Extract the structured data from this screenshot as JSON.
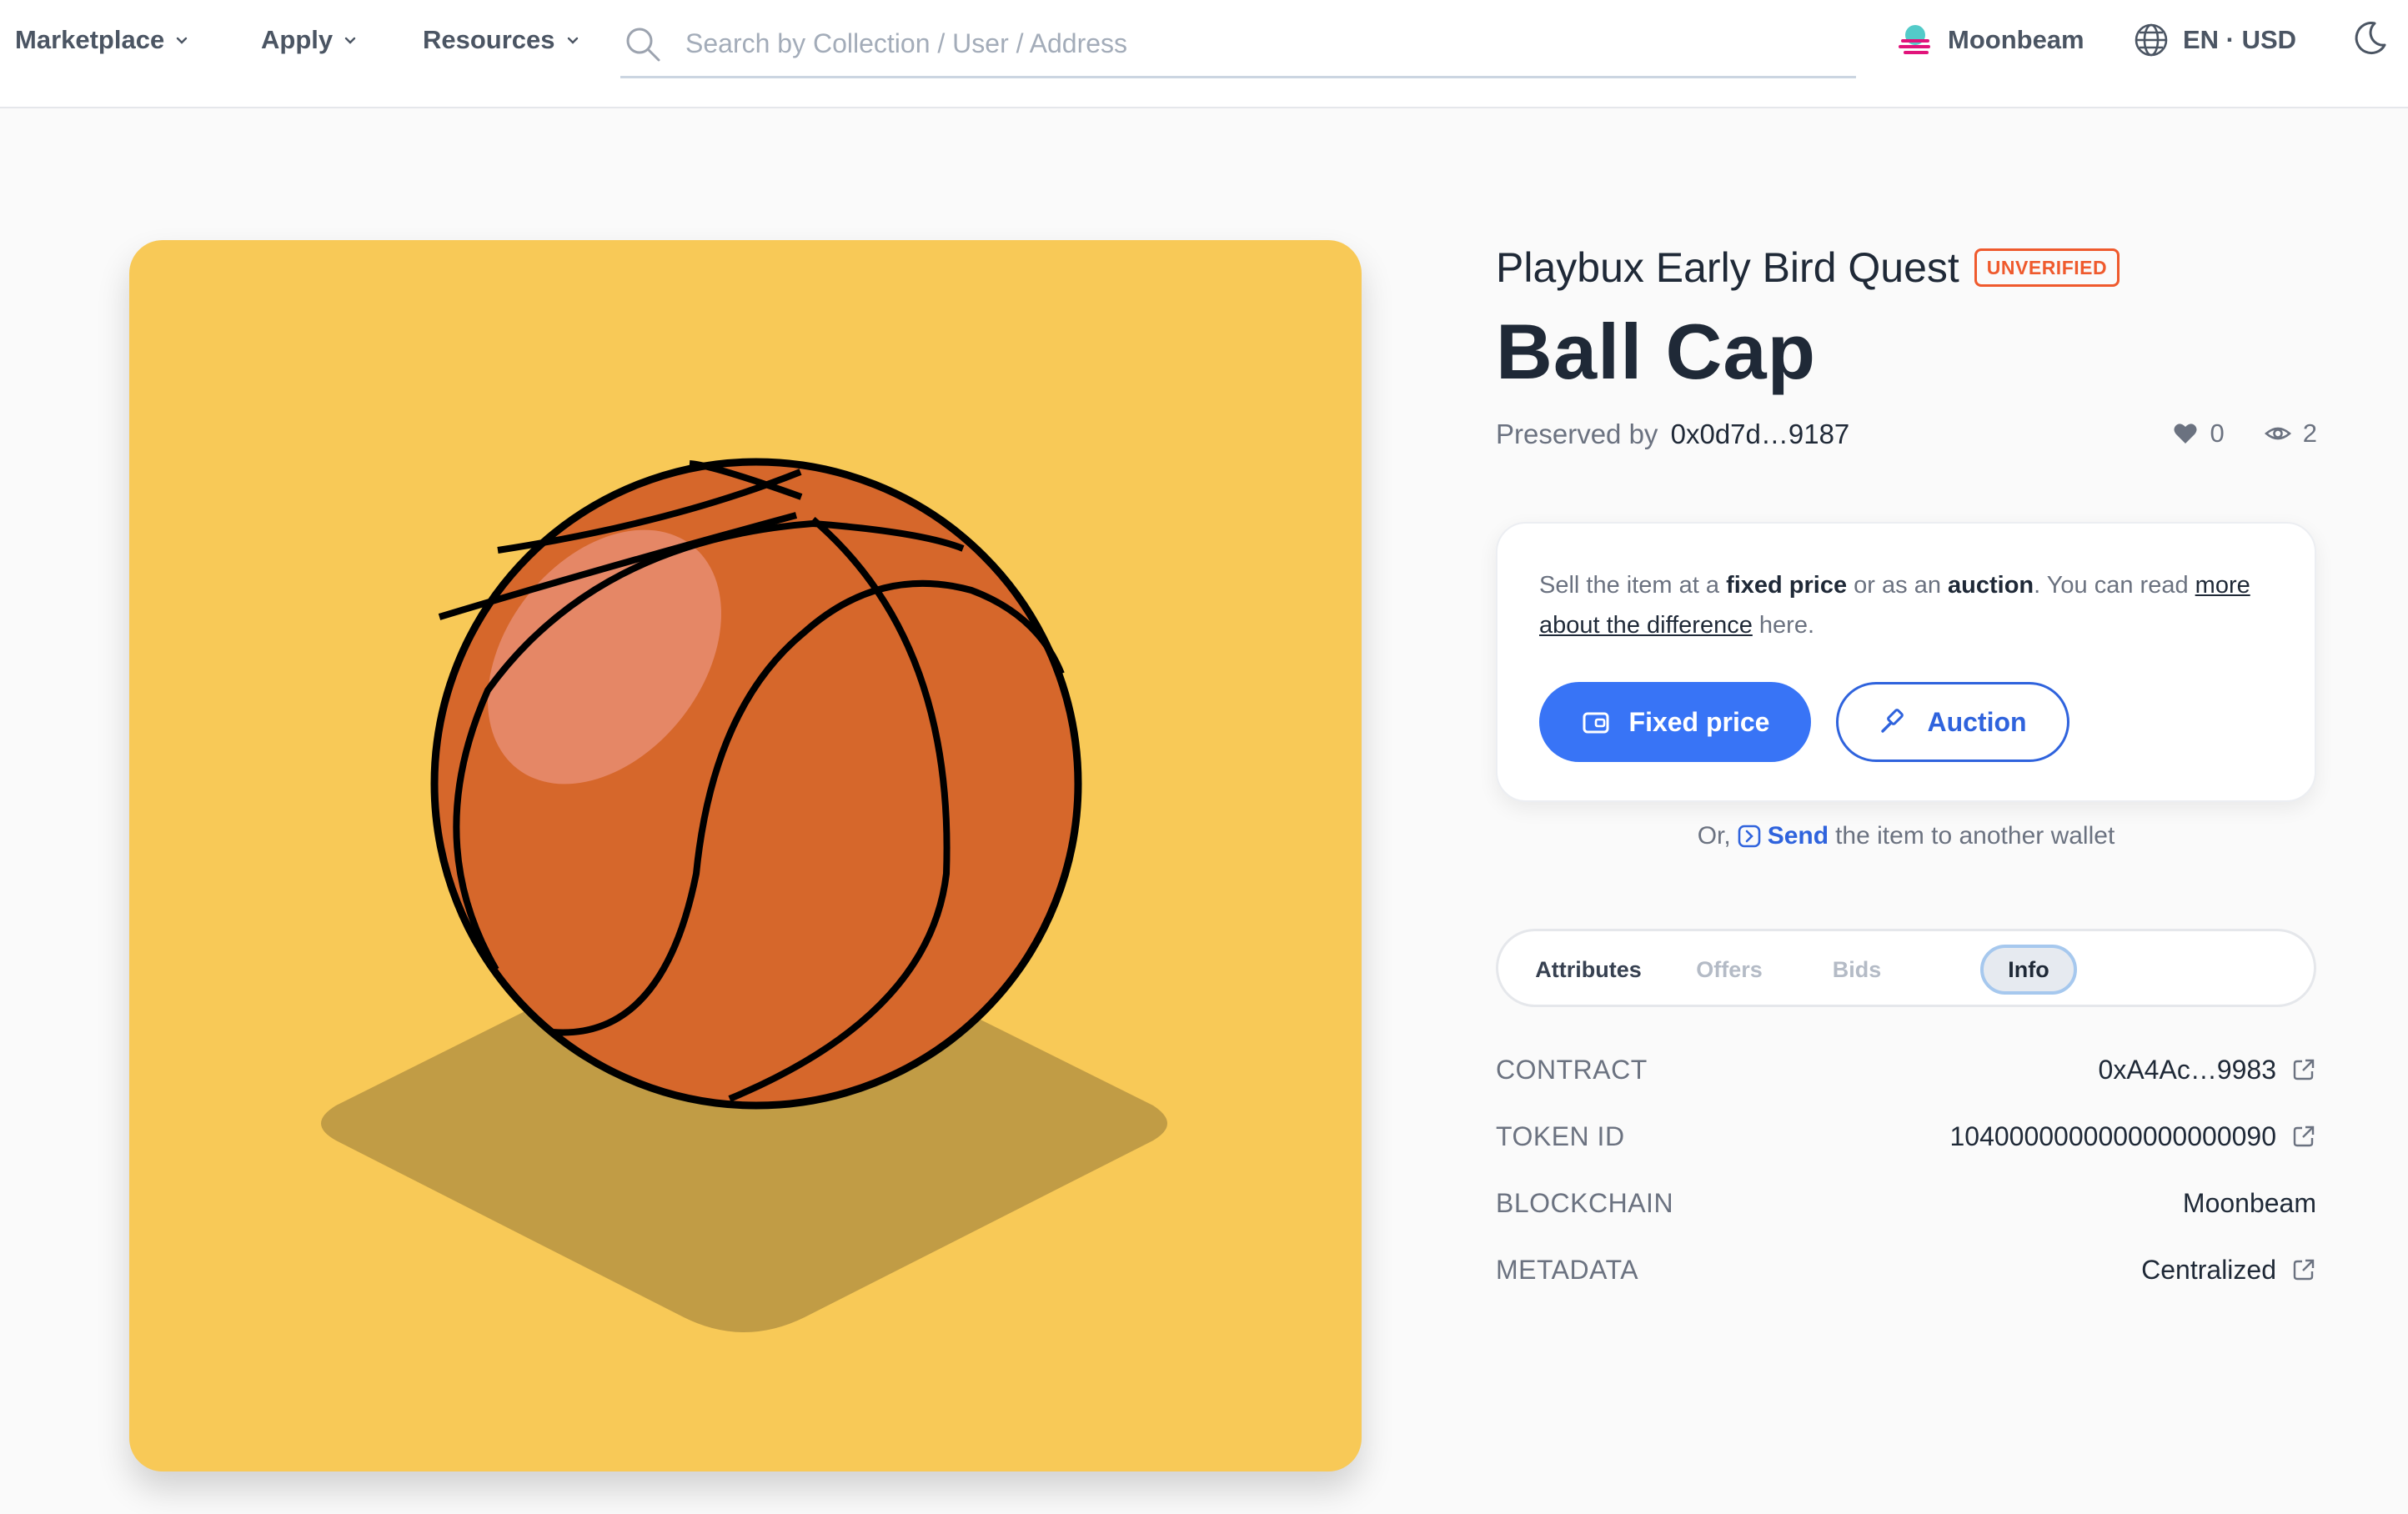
{
  "nav": {
    "marketplace": "Marketplace",
    "apply": "Apply",
    "resources": "Resources"
  },
  "search": {
    "placeholder": "Search by Collection / User / Address"
  },
  "network": {
    "name": "Moonbeam",
    "locale": "EN · USD"
  },
  "item": {
    "collection": "Playbux Early Bird Quest",
    "badge": "UNVERIFIED",
    "title": "Ball Cap",
    "owner_prefix": "Preserved by",
    "owner": "0x0d7d…9187",
    "likes": "0",
    "views": "2"
  },
  "sell": {
    "text_1": "Sell the item at a ",
    "fixed_word": "fixed price",
    "text_2": " or as an ",
    "auction_word": "auction",
    "text_3": ". You can read ",
    "link": "more about the difference",
    "text_4": " here.",
    "fixed_button": "Fixed price",
    "auction_button": "Auction"
  },
  "send": {
    "prefix": "Or,",
    "link": "Send",
    "suffix": "the item to another wallet"
  },
  "tabs": {
    "attributes": "Attributes",
    "offers": "Offers",
    "bids": "Bids",
    "info": "Info",
    "active": "Info"
  },
  "info": {
    "contract_label": "CONTRACT",
    "contract_value": "0xA4Ac…9983",
    "token_label": "TOKEN ID",
    "token_value": "1040000000000000000090",
    "chain_label": "BLOCKCHAIN",
    "chain_value": "Moonbeam",
    "metadata_label": "METADATA",
    "metadata_value": "Centralized"
  },
  "colors": {
    "artwork_background": "#f8c957",
    "ball": "#d6672b",
    "accent_blue": "#3874f6",
    "unverified_orange": "#ef5a2d"
  },
  "icons": {
    "search": "magnifier-icon",
    "network": "moonbeam-logo-icon",
    "locale": "globe-icon",
    "theme": "moon-icon",
    "likes": "heart-icon",
    "views": "eye-icon",
    "fixed": "wallet-icon",
    "auction": "gavel-icon",
    "send": "send-arrow-icon",
    "external": "external-link-icon"
  }
}
